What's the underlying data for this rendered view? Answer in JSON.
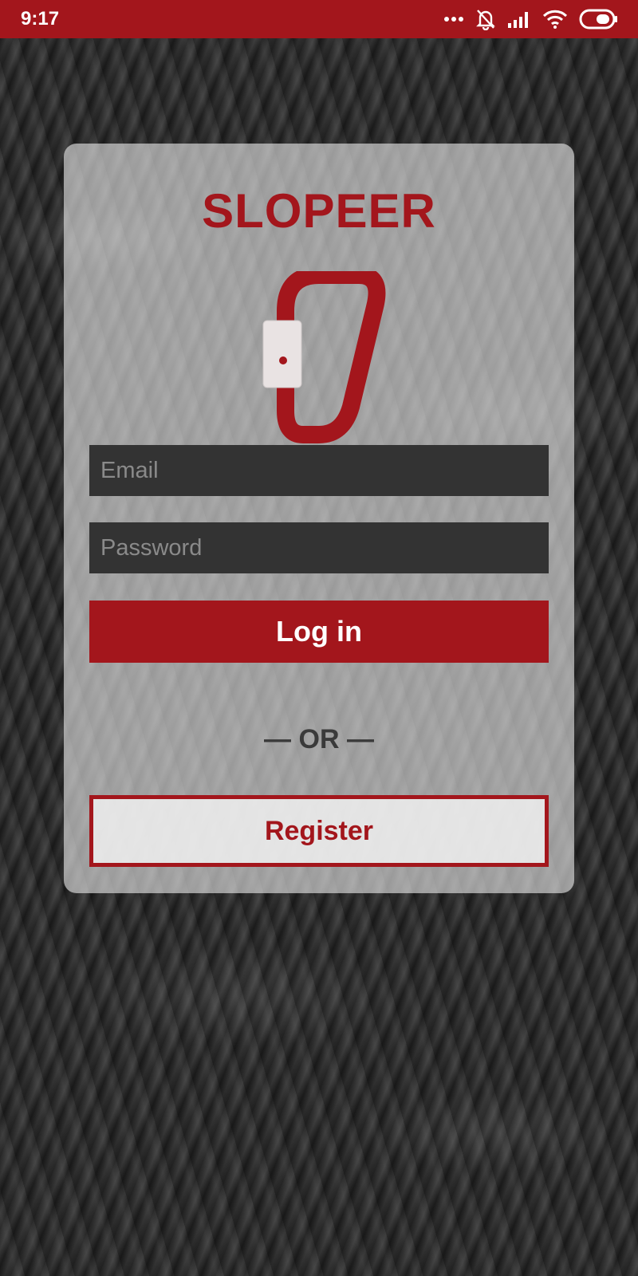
{
  "status_bar": {
    "time": "9:17",
    "icons": [
      "more-dots-icon",
      "notifications-off-icon",
      "signal-icon",
      "wifi-icon",
      "battery-icon"
    ]
  },
  "brand": {
    "name": "SLOPEER",
    "color": "#a3161c",
    "logo_icon": "carabiner-icon"
  },
  "login_form": {
    "email_placeholder": "Email",
    "email_value": "",
    "password_placeholder": "Password",
    "password_value": "",
    "login_label": "Log in",
    "or_label": "— OR —",
    "register_label": "Register"
  },
  "colors": {
    "accent": "#a3161c",
    "field_bg": "#333333",
    "card_bg": "rgba(232,232,232,0.62)"
  }
}
